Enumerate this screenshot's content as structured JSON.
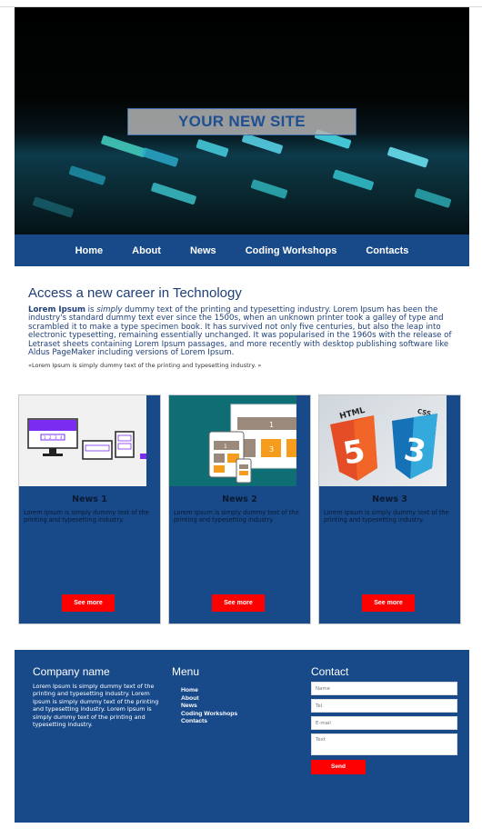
{
  "hero": {
    "title": "YOUR NEW SITE"
  },
  "nav": {
    "items": [
      "Home",
      "About",
      "News",
      "Coding Workshops",
      "Contacts"
    ]
  },
  "intro": {
    "heading": "Access a new career in Technology",
    "lead_bold": "Lorem Ipsum",
    "text_1": " is ",
    "text_italic": "simply",
    "text_2": " dummy text of the printing and typesetting industry. Lorem Ipsum has been the industry's standard dummy text ever since the 1500s, when an unknown printer took a galley of type and scrambled it to make a type specimen book. It has survived not only five centuries, but also the leap into electronic typesetting, remaining essentially unchanged. It was popularised in the 1960s with the release of Letraset sheets containing Lorem Ipsum passages, and more recently with desktop publishing software like Aldus PageMaker including versions of Lorem Ipsum.",
    "quote": "«Lorem Ipsum is simply dummy text of the printing and typesetting industry. »"
  },
  "cards": [
    {
      "title": "News 1",
      "text": "Lorem Ipsum is simply dummy text of the printing and typesetting industry.",
      "button": "See more"
    },
    {
      "title": "News 2",
      "text": "Lorem Ipsum is simply dummy text of the printing and typesetting industry.",
      "button": "See more"
    },
    {
      "title": "News 3",
      "text": "Lorem Ipsum is simply dummy text of the printing and typesetting industry.",
      "button": "See more"
    }
  ],
  "thumb_text": {
    "html": "HTML",
    "css": "CSS",
    "num_1": "1",
    "num_2": "2",
    "num_3": "3",
    "num_4": "4",
    "five": "5",
    "three": "3"
  },
  "footer": {
    "company_title": "Company name",
    "company_text": "Lorem Ipsum is simply dummy text of the printing and typesetting industry. Lorem Ipsum is simply dummy text of the printing and typesetting industry. Lorem Ipsum is simply dummy text of the printing and typesetting industry.",
    "menu_title": "Menu",
    "menu_items": [
      "Home",
      "About",
      "News",
      "Coding Workshops",
      "Contacts"
    ],
    "contact_title": "Contact",
    "placeholders": {
      "name": "Name",
      "tel": "Tel.",
      "email": "E-mail",
      "text": "Text"
    },
    "send": "Send"
  },
  "colors": {
    "primary": "#184a8a",
    "accent": "#ff0000",
    "hero_label": "#1d4f91"
  }
}
